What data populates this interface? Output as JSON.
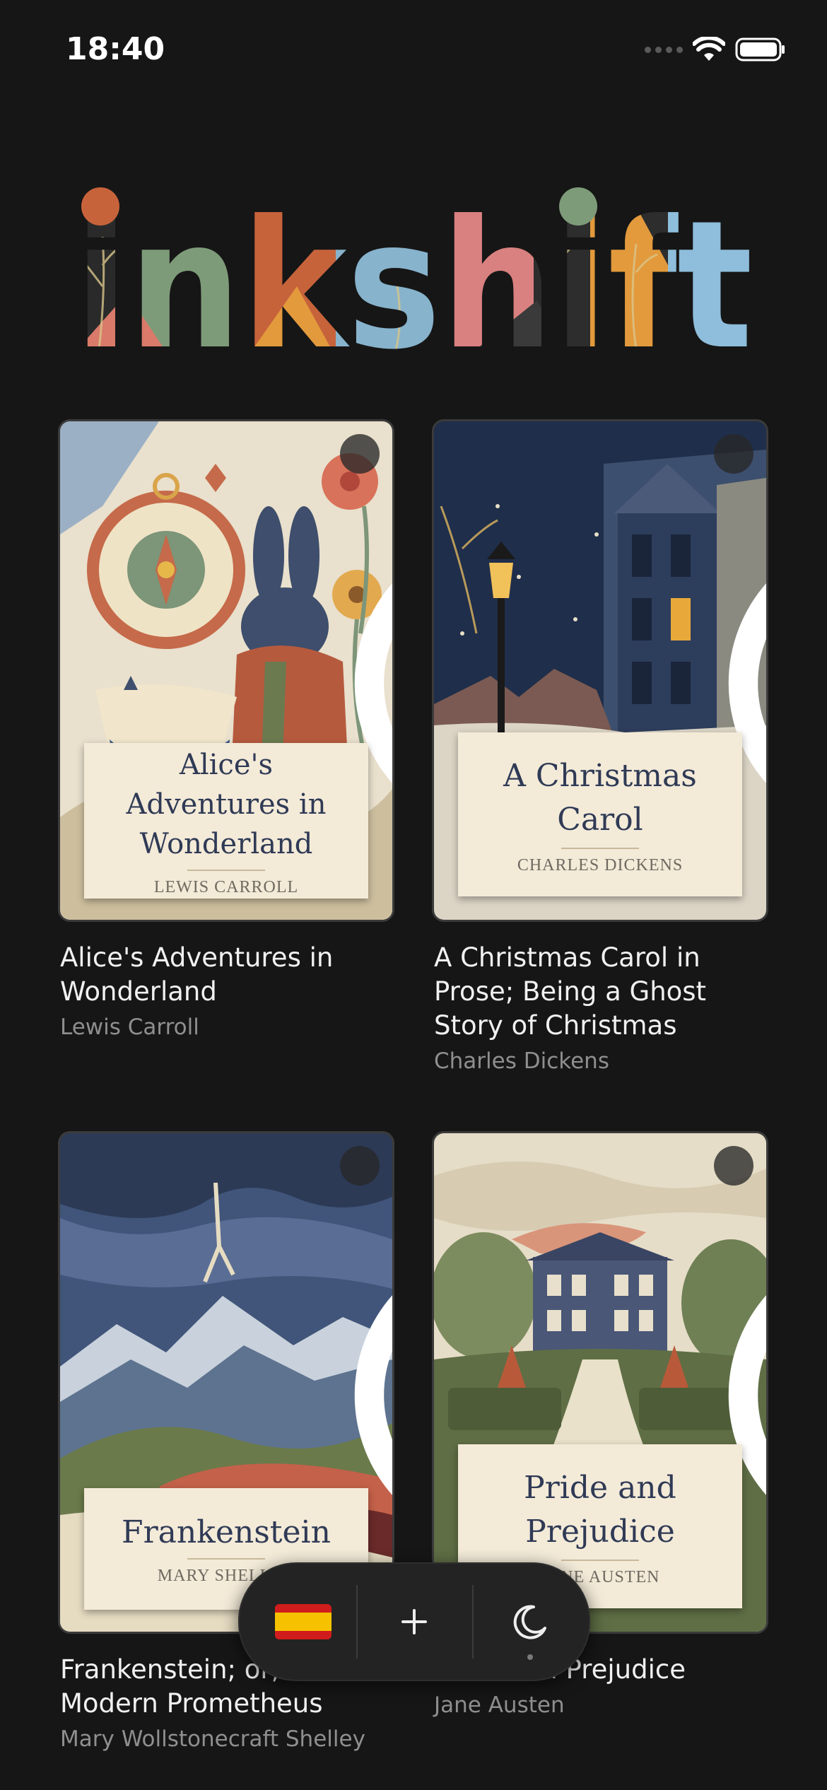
{
  "status": {
    "time": "18:40"
  },
  "app": {
    "name": "inkshift"
  },
  "books": [
    {
      "title": "Alice's Adventures in Wonderland",
      "author": "Lewis Carroll",
      "cover_title": "Alice's Adventures in Wonderland",
      "cover_author": "LEWIS CARROLL"
    },
    {
      "title": "A Christmas Carol in Prose; Being a Ghost Story of Christmas",
      "author": "Charles Dickens",
      "cover_title": "A Christmas Carol",
      "cover_author": "CHARLES DICKENS"
    },
    {
      "title": "Frankenstein; or, The Modern Prometheus",
      "author": "Mary Wollstonecraft Shelley",
      "cover_title": "Frankenstein",
      "cover_author": "MARY SHELLEY"
    },
    {
      "title": "Pride and Prejudice",
      "author": "Jane Austen",
      "cover_title": "Pride and Prejudice",
      "cover_author": "JANE AUSTEN"
    }
  ],
  "toolbar": {
    "language_icon": "spain-flag-icon",
    "add_icon": "plus-icon",
    "theme_icon": "moon-icon"
  },
  "colors": {
    "background": "#161616",
    "plate": "#f3ead8",
    "plate_title": "#2f3a55"
  }
}
